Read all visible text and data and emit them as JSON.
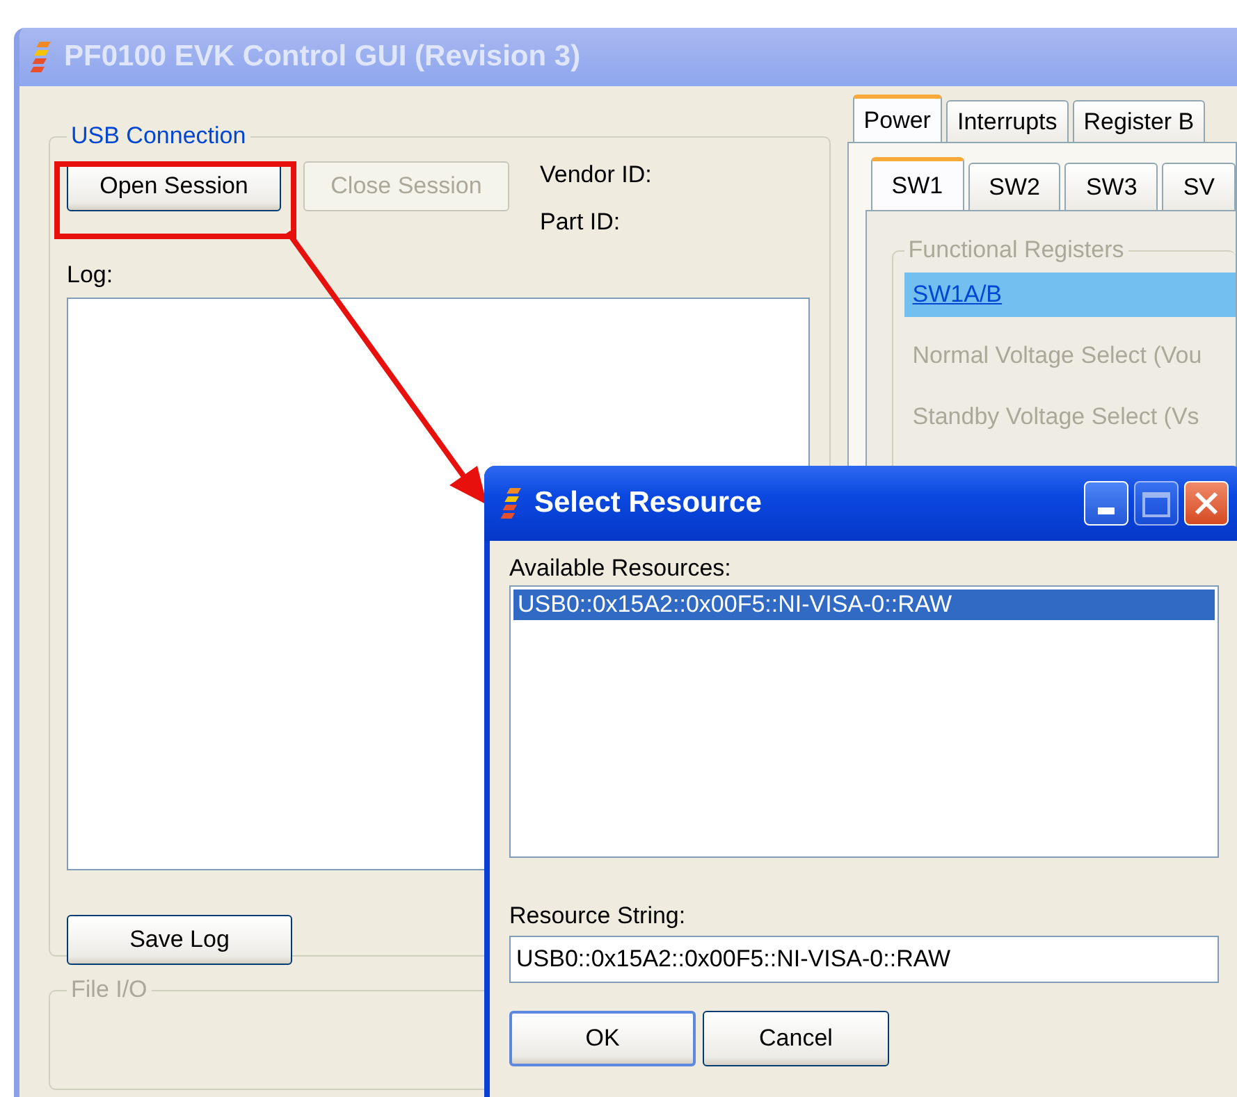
{
  "window": {
    "title": "PF0100 EVK Control GUI (Revision 3)"
  },
  "usb_connection": {
    "title": "USB Connection",
    "buttons": [
      {
        "label": "Open Session",
        "disabled": false
      },
      {
        "label": "Close Session",
        "disabled": true
      }
    ],
    "vendor_id_label": "Vendor ID:",
    "part_id_label": "Part ID:",
    "log_label": "Log:",
    "save_button": "Save Log"
  },
  "file_io": {
    "title": "File I/O"
  },
  "tabs": [
    {
      "label": "Power",
      "selected": true
    },
    {
      "label": "Interrupts",
      "selected": false
    },
    {
      "label": "Register B",
      "selected": false
    }
  ],
  "sub_tabs": [
    {
      "label": "SW1",
      "selected": true
    },
    {
      "label": "SW2",
      "selected": false
    },
    {
      "label": "SW3",
      "selected": false
    },
    {
      "label": "SV",
      "selected": false
    }
  ],
  "functional_registers": {
    "title": "Functional Registers",
    "items": [
      {
        "label": "SW1A/B",
        "selected": true
      },
      {
        "label": "Normal Voltage Select (Vou",
        "selected": false
      },
      {
        "label": "Standby Voltage Select (Vs",
        "selected": false
      }
    ]
  },
  "dialog": {
    "title": "Select Resource",
    "available_label": "Available Resources:",
    "resources": [
      {
        "label": "USB0::0x15A2::0x00F5::NI-VISA-0::RAW",
        "selected": true
      }
    ],
    "resource_string_label": "Resource String:",
    "resource_string": "USB0::0x15A2::0x00F5::NI-VISA-0::RAW",
    "buttons": [
      "OK",
      "Cancel"
    ]
  }
}
